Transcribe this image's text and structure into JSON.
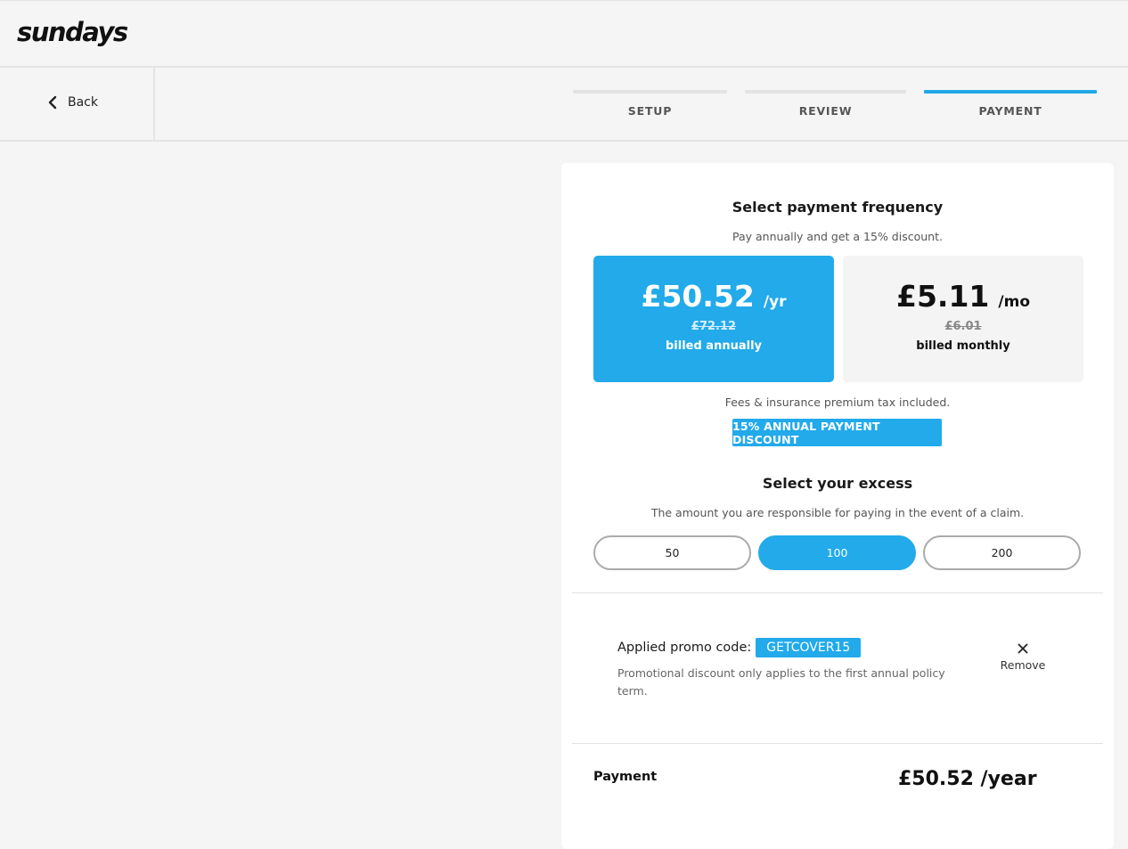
{
  "brand": {
    "logo": "sundays"
  },
  "nav": {
    "back_label": "Back",
    "steps": [
      {
        "label": "SETUP",
        "active": false
      },
      {
        "label": "REVIEW",
        "active": false
      },
      {
        "label": "PAYMENT",
        "active": true
      }
    ]
  },
  "payment_frequency": {
    "title": "Select payment frequency",
    "subtitle": "Pay annually and get a 15% discount.",
    "options": [
      {
        "price": "£50.52",
        "period": "/yr",
        "original": "£72.12",
        "billing": "billed annually",
        "selected": true
      },
      {
        "price": "£5.11",
        "period": "/mo",
        "original": "£6.01",
        "billing": "billed monthly",
        "selected": false
      }
    ],
    "fees_note": "Fees & insurance premium tax included.",
    "discount_badge": "15% ANNUAL PAYMENT DISCOUNT"
  },
  "excess": {
    "title": "Select your excess",
    "subtitle": "The amount you are responsible for paying in the event of a claim.",
    "options": [
      {
        "label": "50",
        "selected": false
      },
      {
        "label": "100",
        "selected": true
      },
      {
        "label": "200",
        "selected": false
      }
    ]
  },
  "promo": {
    "label": "Applied promo code:",
    "code": "GETCOVER15",
    "note": "Promotional discount only applies to the first annual policy term.",
    "remove_label": "Remove"
  },
  "summary": {
    "label": "Payment",
    "amount": "£50.52 /year"
  },
  "colors": {
    "accent": "#22aaea",
    "background": "#f5f5f5",
    "card": "#ffffff"
  }
}
